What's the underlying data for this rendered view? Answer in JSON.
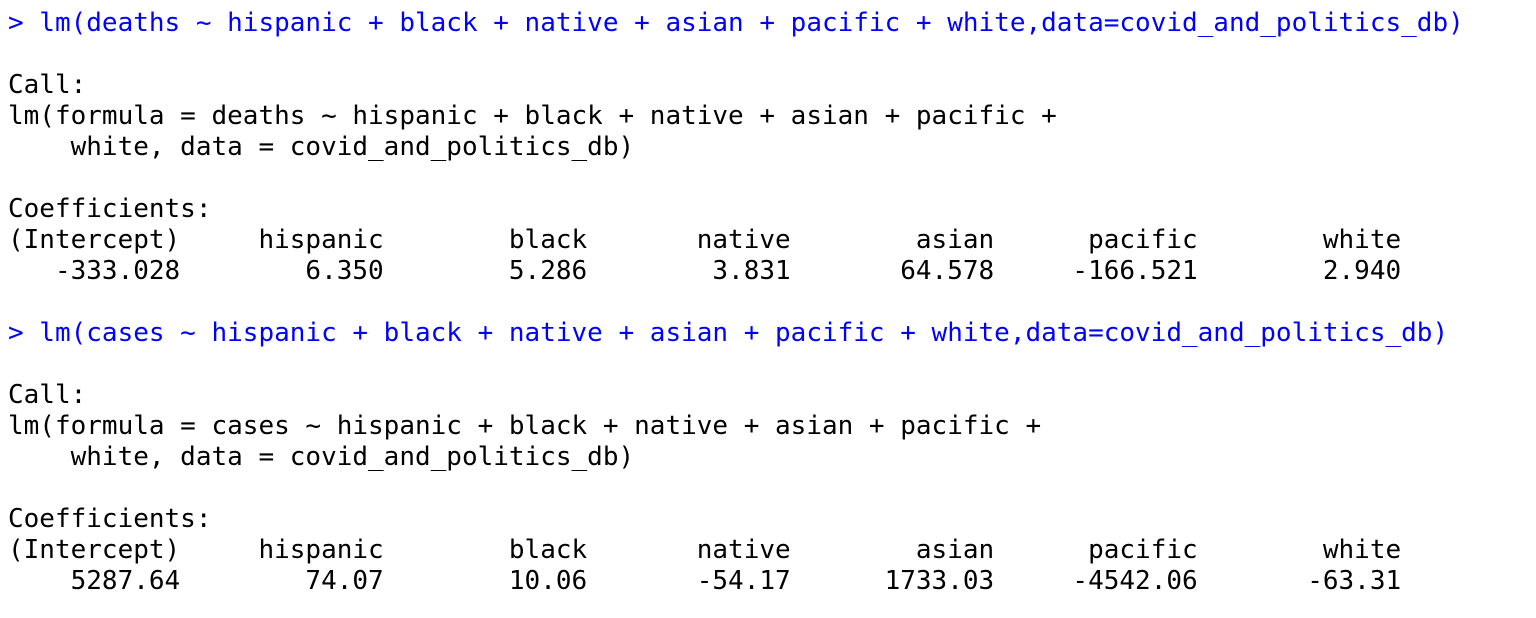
{
  "colors": {
    "command": "#0000ff",
    "output": "#000000",
    "background": "#ffffff"
  },
  "blocks": [
    {
      "command": "> lm(deaths ~ hispanic + black + native + asian + pacific + white,data=covid_and_politics_db)",
      "call_label": "Call:",
      "call_line1": "lm(formula = deaths ~ hispanic + black + native + asian + pacific + ",
      "call_line2": "    white, data = covid_and_politics_db)",
      "coef_label": "Coefficients:",
      "coef_header": "(Intercept)     hispanic        black       native        asian      pacific        white  ",
      "coef_values": "   -333.028        6.350        5.286        3.831       64.578     -166.521        2.940  "
    },
    {
      "command": "> lm(cases ~ hispanic + black + native + asian + pacific + white,data=covid_and_politics_db)",
      "call_label": "Call:",
      "call_line1": "lm(formula = cases ~ hispanic + black + native + asian + pacific + ",
      "call_line2": "    white, data = covid_and_politics_db)",
      "coef_label": "Coefficients:",
      "coef_header": "(Intercept)     hispanic        black       native        asian      pacific        white  ",
      "coef_values": "    5287.64        74.07        10.06       -54.17      1733.03     -4542.06       -63.31  "
    }
  ]
}
